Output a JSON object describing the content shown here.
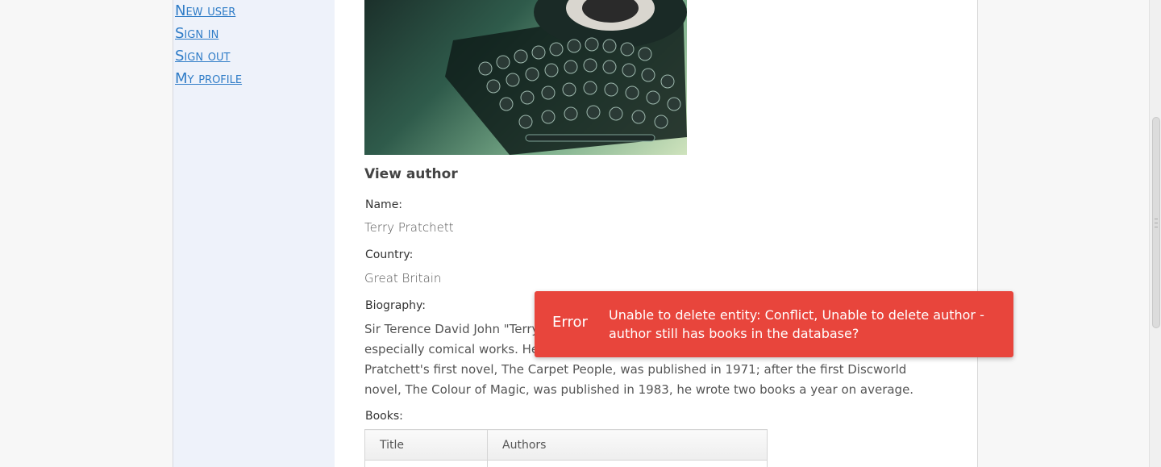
{
  "sidebar": {
    "links": [
      "New user",
      "Sign in",
      "Sign out",
      "My profile"
    ]
  },
  "author": {
    "section_title": "View author",
    "name_label": "Name:",
    "name_value": "Terry Pratchett",
    "country_label": "Country:",
    "country_value": "Great Britain",
    "biography_label": "Biography:",
    "biography_value": "Sir Terence David John \"Terry\" Pratchett, OBE, was an English author of fantasy novels, especially comical works. He is best known for his Discworld series of about 40 volumes. Pratchett's first novel, The Carpet People, was published in 1971; after the first Discworld novel, The Colour of Magic, was published in 1983, he wrote two books a year on average.",
    "books_label": "Books:",
    "books_columns": [
      "Title",
      "Authors"
    ]
  },
  "toast": {
    "title": "Error",
    "message": "Unable to delete entity: Conflict, Unable to delete author - author still has books in the database?",
    "color": "#e8453c"
  },
  "colors": {
    "link": "#2f7cc7",
    "sidebar_bg": "#eef2fa"
  },
  "icons": {
    "author_photo": "typewriter-photo"
  }
}
